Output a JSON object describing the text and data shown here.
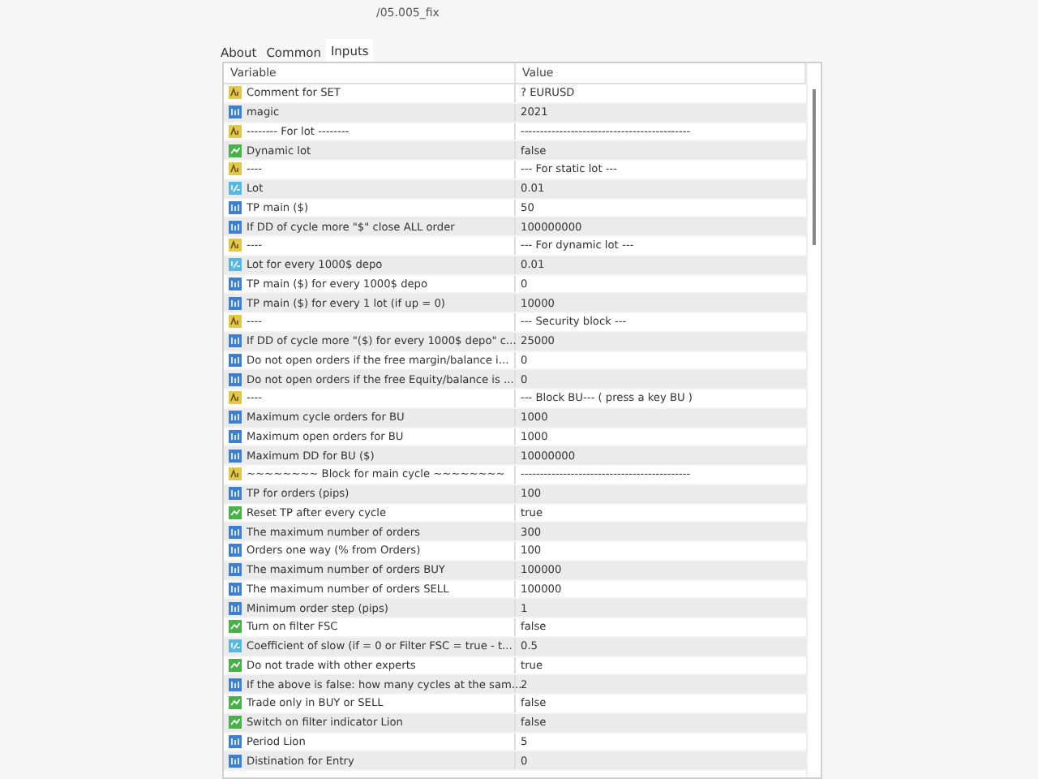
{
  "window": {
    "title": "/05.005_fix"
  },
  "tabs": [
    {
      "label": "About",
      "selected": false
    },
    {
      "label": "Common",
      "selected": false
    },
    {
      "label": "Inputs",
      "selected": true
    }
  ],
  "table": {
    "columns": [
      "Variable",
      "Value"
    ],
    "rows": [
      {
        "kind": "string",
        "variable": "Comment for SET",
        "value": "? EURUSD"
      },
      {
        "kind": "int",
        "variable": "magic",
        "value": "2021"
      },
      {
        "kind": "string",
        "variable": "--------   For lot   --------",
        "value": "--------------------------------------------"
      },
      {
        "kind": "bool",
        "variable": "Dynamic lot",
        "value": "false"
      },
      {
        "kind": "string",
        "variable": "----",
        "value": "--- For static lot ---"
      },
      {
        "kind": "double",
        "variable": "Lot",
        "value": "0.01"
      },
      {
        "kind": "int",
        "variable": "TP main ($)",
        "value": "50"
      },
      {
        "kind": "int",
        "variable": "If DD of cycle more \"$\" close ALL order",
        "value": "100000000"
      },
      {
        "kind": "string",
        "variable": "----",
        "value": "--- For dynamic lot ---"
      },
      {
        "kind": "double",
        "variable": "Lot for every 1000$ depo",
        "value": "0.01"
      },
      {
        "kind": "int",
        "variable": "TP main ($) for every 1000$ depo",
        "value": "0"
      },
      {
        "kind": "int",
        "variable": "TP main ($) for every 1 lot (if up = 0)",
        "value": "10000"
      },
      {
        "kind": "string",
        "variable": "----",
        "value": "--- Security block ---"
      },
      {
        "kind": "int",
        "variable": "If DD of cycle more \"($) for every 1000$ depo\" c...",
        "value": "25000"
      },
      {
        "kind": "int",
        "variable": "Do not open orders if the free margin/balance i...",
        "value": "0"
      },
      {
        "kind": "int",
        "variable": "Do not open orders if the free Equity/balance is ...",
        "value": "0"
      },
      {
        "kind": "string",
        "variable": "----",
        "value": "--- Block BU--- ( press a key BU )"
      },
      {
        "kind": "int",
        "variable": "Maximum cycle orders for BU",
        "value": "1000"
      },
      {
        "kind": "int",
        "variable": "Maximum open orders for BU",
        "value": "1000"
      },
      {
        "kind": "int",
        "variable": "Maximum DD for BU ($)",
        "value": "10000000"
      },
      {
        "kind": "string",
        "variable": "~~~~~~~~  Block for main cycle  ~~~~~~~~",
        "value": "--------------------------------------------"
      },
      {
        "kind": "int",
        "variable": "TP for orders (pips)",
        "value": "100"
      },
      {
        "kind": "bool",
        "variable": "Reset TP after every cycle",
        "value": "true"
      },
      {
        "kind": "int",
        "variable": "The maximum number of orders",
        "value": "300"
      },
      {
        "kind": "int",
        "variable": "Orders one way (% from Orders)",
        "value": "100"
      },
      {
        "kind": "int",
        "variable": "The maximum number of orders BUY",
        "value": "100000"
      },
      {
        "kind": "int",
        "variable": "The maximum number of orders SELL",
        "value": "100000"
      },
      {
        "kind": "int",
        "variable": "Minimum order step (pips)",
        "value": "1"
      },
      {
        "kind": "bool",
        "variable": "Turn on filter FSC",
        "value": "false"
      },
      {
        "kind": "double",
        "variable": "Coefficient of slow (if = 0 or Filter FSC = true - t...",
        "value": "0.5"
      },
      {
        "kind": "bool",
        "variable": "Do not trade with other experts",
        "value": "true"
      },
      {
        "kind": "int",
        "variable": "If the above is false: how many cycles at the sam...",
        "value": "2"
      },
      {
        "kind": "bool",
        "variable": "Trade only in BUY or SELL",
        "value": "false"
      },
      {
        "kind": "bool",
        "variable": "Switch on filter indicator Lion",
        "value": "false"
      },
      {
        "kind": "int",
        "variable": "Period Lion",
        "value": "5"
      },
      {
        "kind": "int",
        "variable": "Distination for Entry",
        "value": "0"
      }
    ]
  }
}
